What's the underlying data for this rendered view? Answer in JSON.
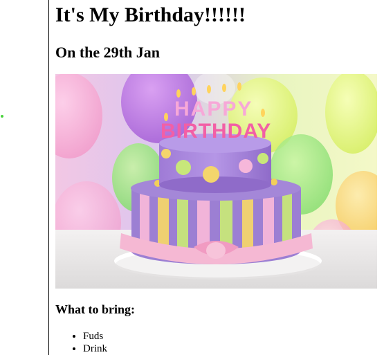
{
  "heading": "It's My Birthday!!!!!!",
  "subheading": "On the 29th Jan",
  "image": {
    "alt": "Birthday cake photo",
    "cake_topper_line1": "HAPPY",
    "cake_topper_line2": "BIRTHDAY"
  },
  "bring_title": "What to bring:",
  "bring_items": [
    "Fuds",
    "Drink"
  ],
  "colors": {
    "dot": "#4ad33d",
    "rule": "#000000"
  }
}
